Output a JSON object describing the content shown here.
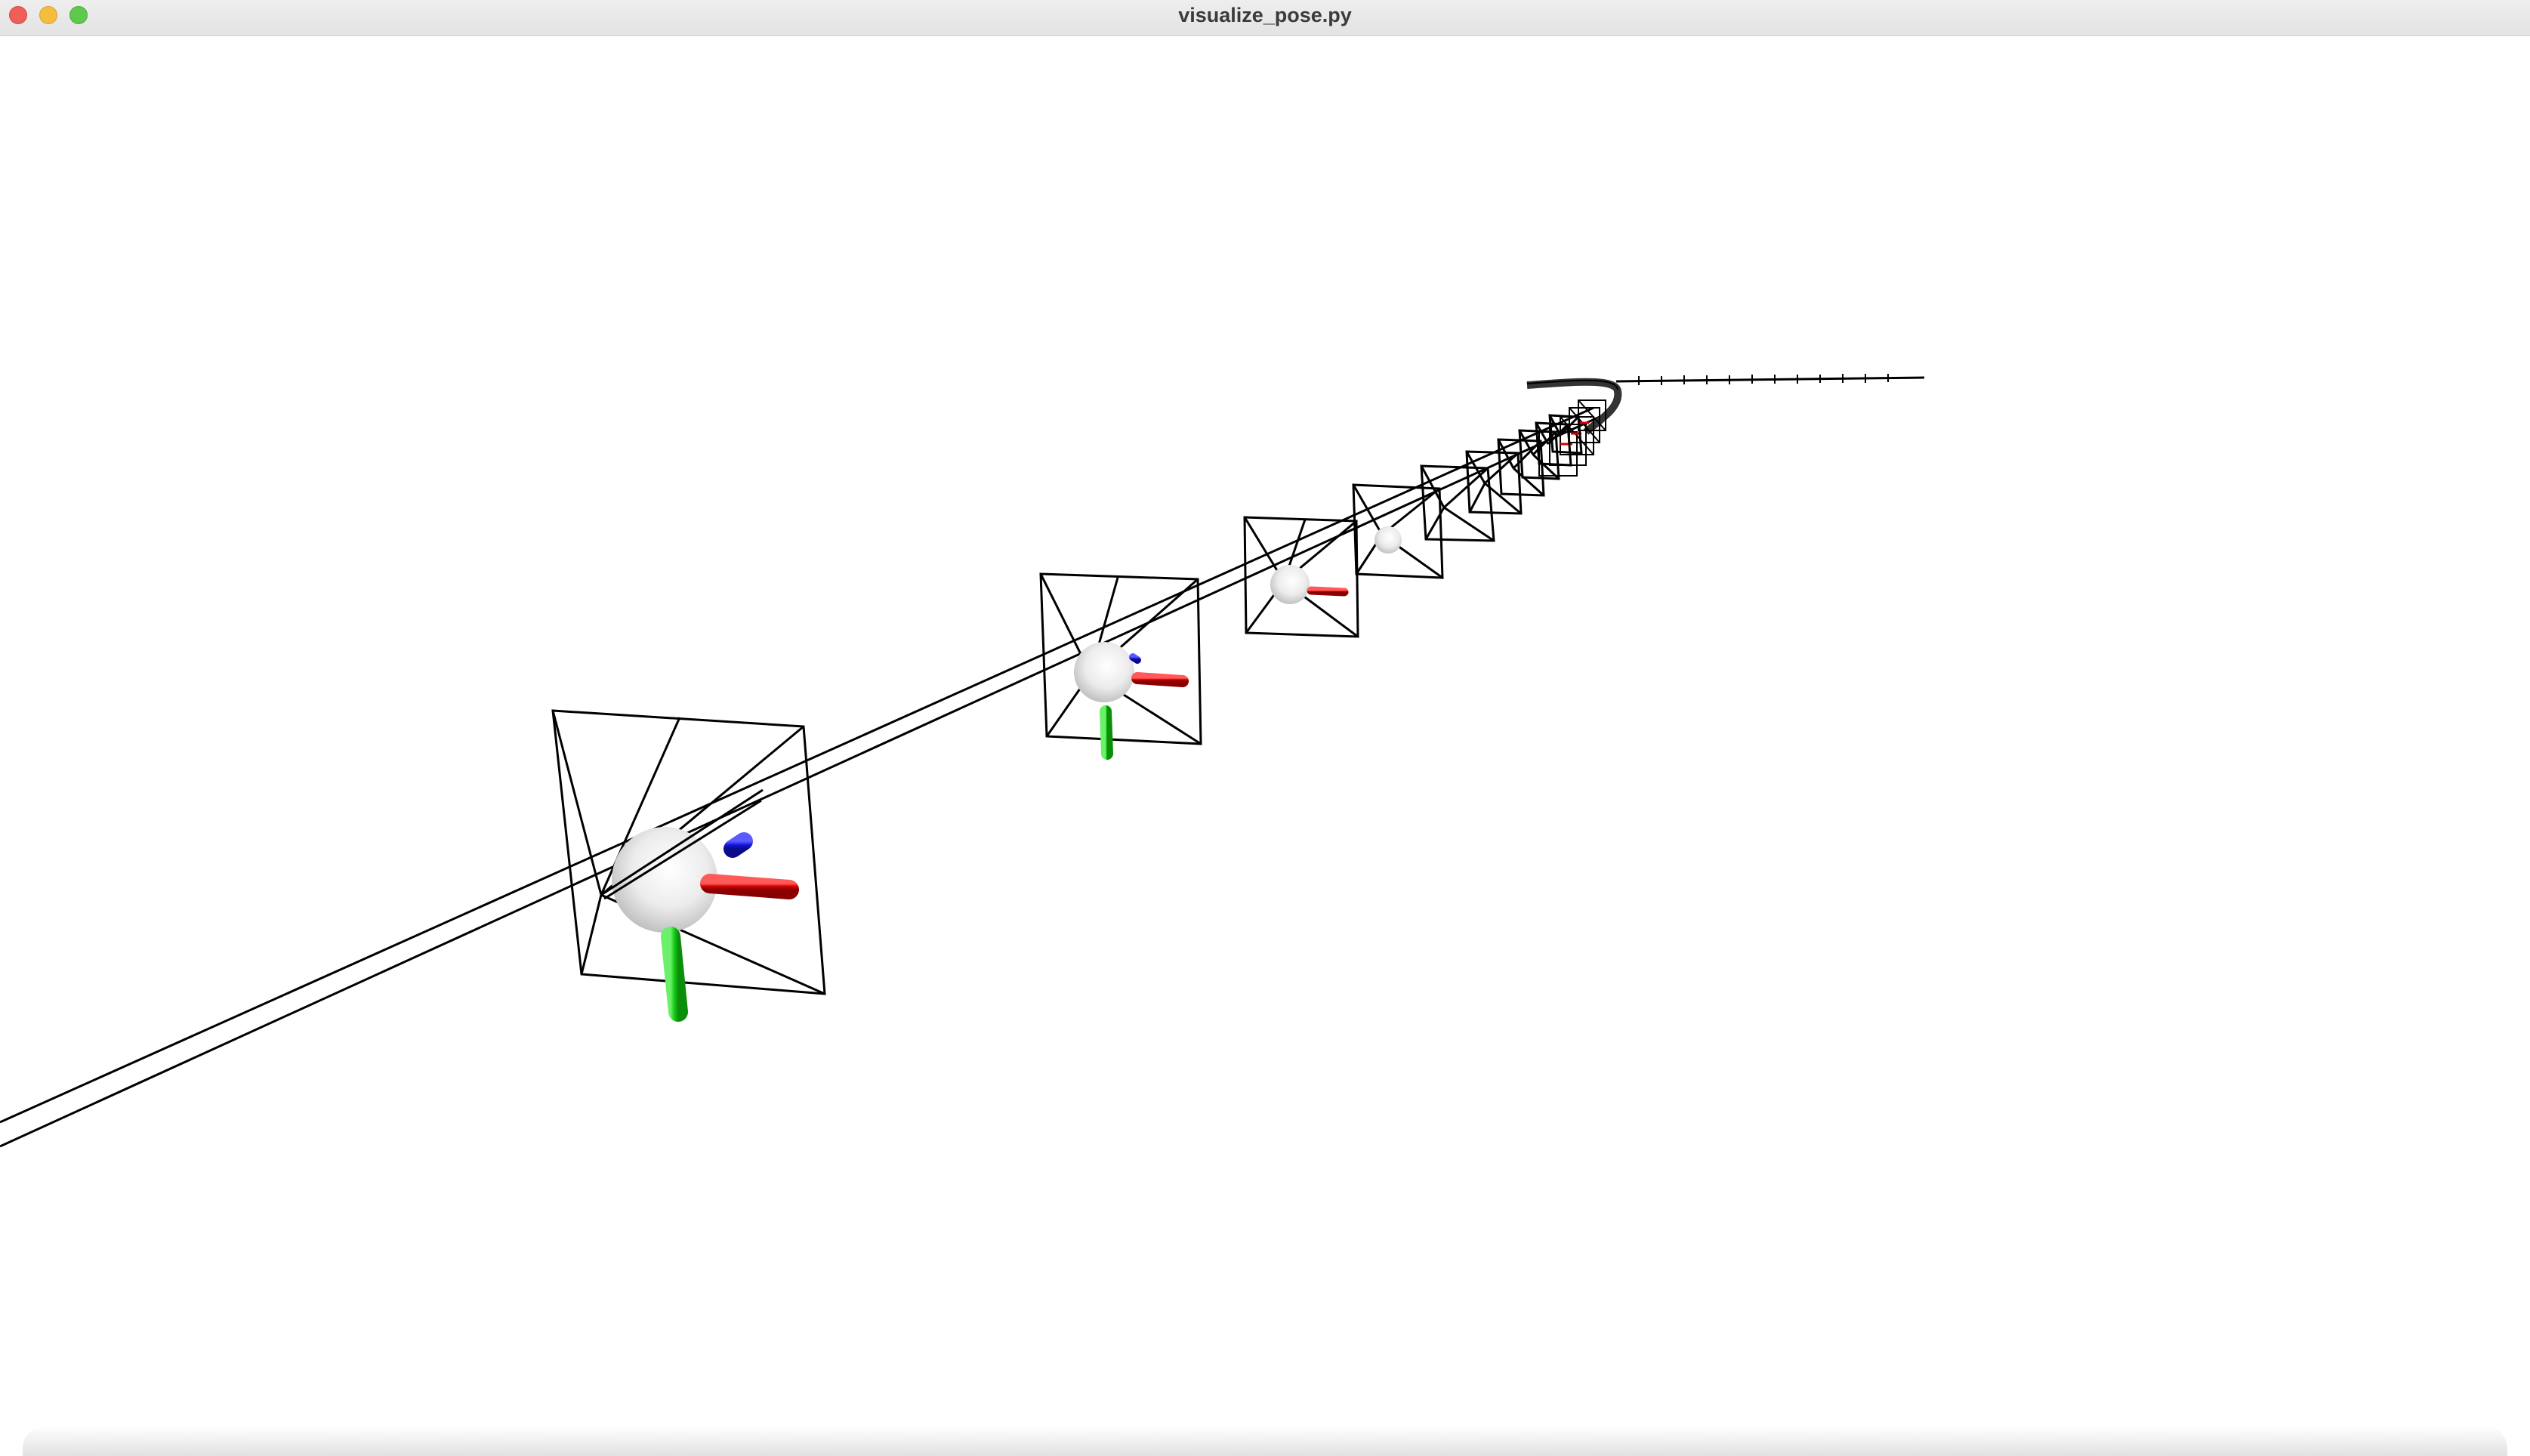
{
  "window": {
    "title": "visualize_pose.py",
    "controls": [
      "close-button",
      "minimize-button",
      "zoom-button"
    ]
  },
  "scene": {
    "background": "#ffffff",
    "line_color": "#000000",
    "axis_colors": {
      "x": "#d40000",
      "y": "#18d018",
      "z": "#1414d8"
    },
    "camera_body_color": "#e4e4e4",
    "camera_frustum_count_visible_detailed": 10
  }
}
